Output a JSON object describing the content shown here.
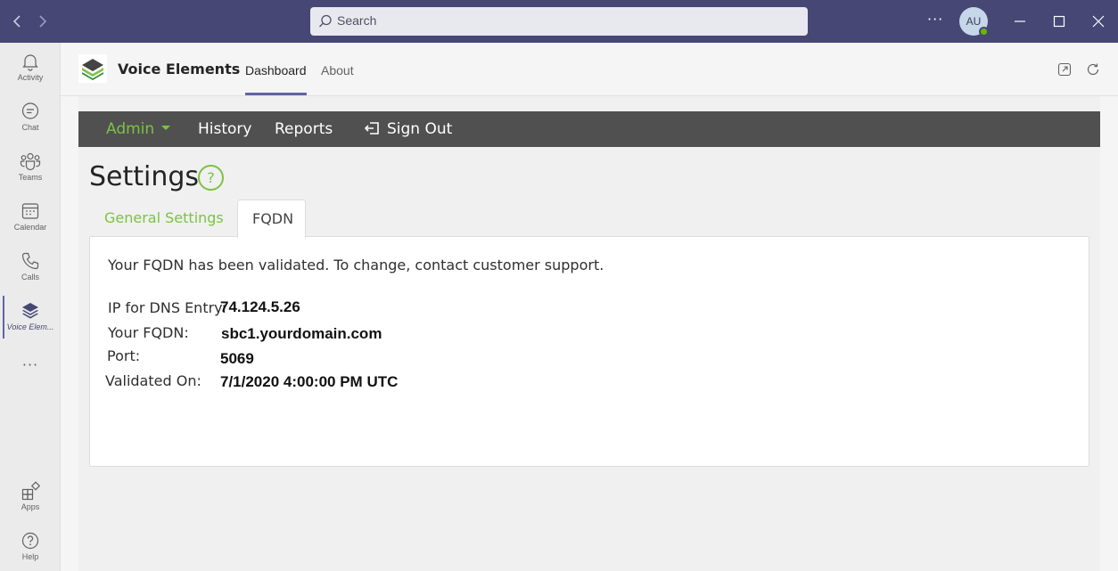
{
  "titlebar": {
    "back_icon": "chevron-left-icon",
    "forward_icon": "chevron-right-icon",
    "search_placeholder": "Search",
    "more": "···",
    "avatar_initials": "AU"
  },
  "rail": {
    "items": [
      {
        "label": "Activity",
        "icon": "bell-icon"
      },
      {
        "label": "Chat",
        "icon": "chat-icon"
      },
      {
        "label": "Teams",
        "icon": "teams-icon"
      },
      {
        "label": "Calendar",
        "icon": "calendar-icon"
      },
      {
        "label": "Calls",
        "icon": "phone-icon"
      },
      {
        "label": "Voice Elem...",
        "icon": "voice-elements-icon"
      }
    ],
    "more": "···",
    "bottom": [
      {
        "label": "Apps",
        "icon": "apps-icon"
      },
      {
        "label": "Help",
        "icon": "help-icon"
      }
    ]
  },
  "app": {
    "title": "Voice Elements",
    "tabs": [
      {
        "label": "Dashboard",
        "active": true
      },
      {
        "label": "About",
        "active": false
      }
    ]
  },
  "menu": {
    "admin": "Admin",
    "history": "History",
    "reports": "Reports",
    "signout": "Sign Out"
  },
  "page": {
    "title": "Settings",
    "help": "?",
    "tabs": {
      "general": "General Settings",
      "fqdn": "FQDN"
    }
  },
  "fqdn": {
    "message": "Your FQDN has been validated. To change, contact customer support.",
    "ip_label": "IP for DNS Entry:",
    "ip_value": "74.124.5.26",
    "fqdn_label": "Your FQDN:",
    "fqdn_value": "sbc1.yourdomain.com",
    "port_label": "Port:",
    "port_value": "5069",
    "validated_label": "Validated On:",
    "validated_value": "7/1/2020 4:00:00 PM UTC"
  },
  "colors": {
    "titlebar": "#464775",
    "accent": "#6264a7",
    "brand_green": "#7cc242",
    "menubar": "#505050"
  }
}
